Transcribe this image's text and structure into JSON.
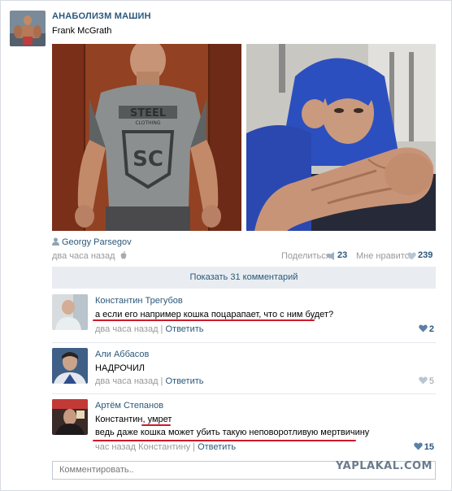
{
  "post": {
    "group_name": "АНАБОЛИЗМ МАШИН",
    "author": "Frank McGrath",
    "signer": "Georgy Parsegov",
    "time": "два часа назад",
    "share_label": "Поделиться",
    "share_count": "23",
    "like_label": "Мне нравится",
    "like_count": "239",
    "show_comments": "Показать 31 комментарий"
  },
  "comments": [
    {
      "name": "Константин Трегубов",
      "line1": "а если его например кошка поцарапает, что с ним будет?",
      "time": "два часа назад",
      "reply": "Ответить",
      "likes": "2"
    },
    {
      "name": "Али Аббасов",
      "line1": "НАДРОЧИЛ",
      "time": "два часа назад",
      "reply": "Ответить",
      "likes": "5"
    },
    {
      "name": "Артём Степанов",
      "line1": "Константин, умрет",
      "line2": "ведь даже кошка может убить такую неповоротливую мертвичину",
      "time": "час назад Константину",
      "reply": "Ответить",
      "likes": "15"
    }
  ],
  "comment_input": {
    "placeholder": "Комментировать.."
  },
  "watermark": "YAPLAKAL.COM",
  "colors": {
    "link": "#2b587a",
    "muted": "#999999",
    "underline": "#cc1a2c",
    "panel": "#e9edf1"
  }
}
